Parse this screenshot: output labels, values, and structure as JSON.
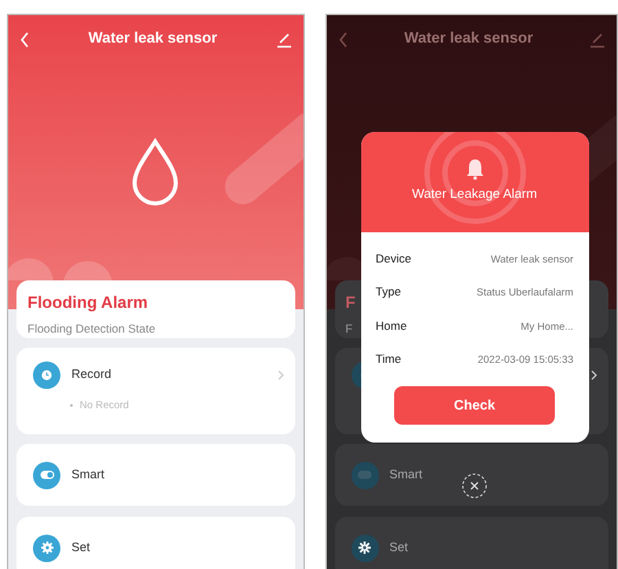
{
  "device_screen": {
    "title": "Water leak sensor",
    "flood_card": {
      "title": "Flooding Alarm",
      "subtitle": "Flooding Detection State"
    },
    "record": {
      "label": "Record",
      "empty_text": "No Record"
    },
    "smart": {
      "label": "Smart"
    },
    "set": {
      "label": "Set"
    }
  },
  "alarm_screen": {
    "background": {
      "title": "Water leak sensor",
      "flood_title": "F",
      "flood_subtitle": "F",
      "smart_label": "Smart",
      "set_label": "Set"
    },
    "dialog": {
      "title": "Water Leakage Alarm",
      "rows": [
        {
          "label": "Device",
          "value": "Water leak sensor"
        },
        {
          "label": "Type",
          "value": "Status Uberlaufalarm"
        },
        {
          "label": "Home",
          "value": "My Home..."
        },
        {
          "label": "Time",
          "value": "2022-03-09 15:05:33"
        }
      ],
      "button": "Check"
    }
  }
}
